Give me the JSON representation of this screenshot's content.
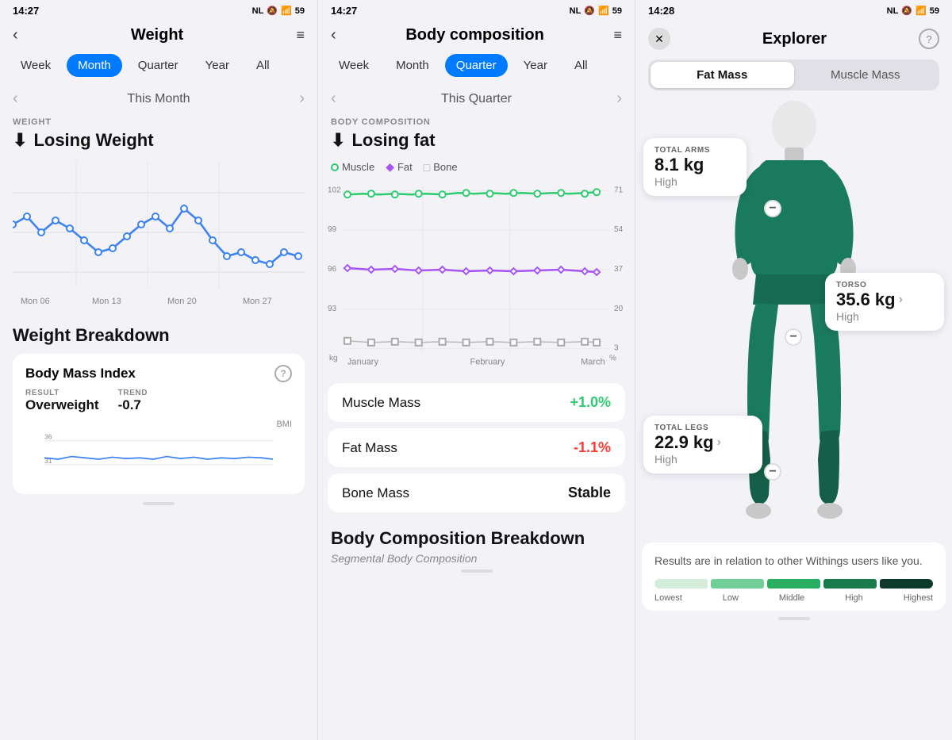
{
  "panel1": {
    "status_time": "14:27",
    "header": {
      "title": "Weight",
      "back_label": "‹"
    },
    "tabs": [
      "Week",
      "Month",
      "Quarter",
      "Year",
      "All"
    ],
    "active_tab": "Month",
    "period_label": "This Month",
    "section_label": "WEIGHT",
    "section_title": "Losing Weight",
    "trend_icon": "⬇",
    "x_labels": [
      "Mon 06",
      "Mon 13",
      "Mon 20",
      "Mon 27"
    ],
    "breakdown_title": "Weight Breakdown",
    "bmi_card": {
      "title": "Body Mass Index",
      "result_label": "RESULT",
      "result_value": "Overweight",
      "trend_label": "TREND",
      "trend_value": "-0.7",
      "chart_label": "BMI",
      "y_values": [
        "36",
        "31"
      ]
    }
  },
  "panel2": {
    "status_time": "14:27",
    "header": {
      "title": "Body composition",
      "back_label": "‹"
    },
    "tabs": [
      "Week",
      "Month",
      "Quarter",
      "Year",
      "All"
    ],
    "active_tab": "Quarter",
    "period_label": "This Quarter",
    "section_label": "BODY COMPOSITION",
    "section_title": "Losing fat",
    "trend_icon": "⬇",
    "legend": {
      "muscle_label": "Muscle",
      "fat_label": "Fat",
      "bone_label": "Bone"
    },
    "chart_y_left": [
      "102",
      "99",
      "96",
      "93"
    ],
    "chart_y_right": [
      "71",
      "54",
      "37",
      "20",
      "3"
    ],
    "chart_x": [
      "January",
      "February",
      "March"
    ],
    "metrics": [
      {
        "name": "Muscle Mass",
        "value": "+1.0%",
        "type": "positive"
      },
      {
        "name": "Fat Mass",
        "value": "-1.1%",
        "type": "negative"
      },
      {
        "name": "Bone Mass",
        "value": "Stable",
        "type": "stable"
      }
    ],
    "breakdown_title": "Body Composition Breakdown",
    "segmental_label": "Segmental Body Composition"
  },
  "panel3": {
    "status_time": "14:28",
    "header": {
      "title": "Explorer"
    },
    "toggle_tabs": [
      "Fat Mass",
      "Muscle Mass"
    ],
    "active_toggle": "Fat Mass",
    "body_regions": [
      {
        "id": "arms",
        "label": "TOTAL ARMS",
        "value": "8.1 kg",
        "status": "High",
        "has_arrow": false
      },
      {
        "id": "torso",
        "label": "TORSO",
        "value": "35.6 kg",
        "status": "High",
        "has_arrow": true
      },
      {
        "id": "legs",
        "label": "TOTAL LEGS",
        "value": "22.9 kg",
        "status": "High",
        "has_arrow": true
      }
    ],
    "legend_text": "Results are in relation to other Withings users like you.",
    "legend_labels": [
      "Lowest",
      "Low",
      "Middle",
      "High",
      "Highest"
    ],
    "legend_colors": [
      "#d4edda",
      "#6fcf97",
      "#27ae60",
      "#1a7a4a",
      "#0d3b2b"
    ]
  }
}
